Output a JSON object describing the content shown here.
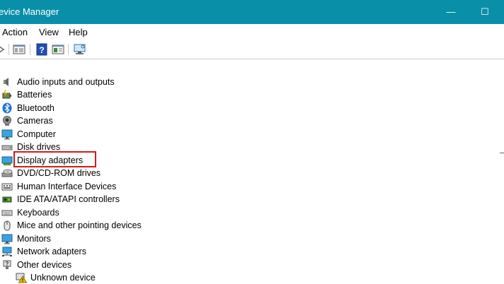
{
  "window": {
    "title": "evice Manager",
    "minimize_glyph": "—",
    "maximize_glyph": "☐"
  },
  "menu": {
    "items": [
      "Action",
      "View",
      "Help"
    ]
  },
  "toolbar": {
    "icons": [
      "forward-arrow-icon",
      "properties-icon",
      "help-icon",
      "update-driver-icon",
      "scan-hardware-icon"
    ]
  },
  "tree": {
    "categories": [
      {
        "label": "Audio inputs and outputs",
        "icon": "speaker-icon"
      },
      {
        "label": "Batteries",
        "icon": "battery-icon"
      },
      {
        "label": "Bluetooth",
        "icon": "bluetooth-icon"
      },
      {
        "label": "Cameras",
        "icon": "camera-icon"
      },
      {
        "label": "Computer",
        "icon": "computer-icon"
      },
      {
        "label": "Disk drives",
        "icon": "disk-drive-icon"
      },
      {
        "label": "Display adapters",
        "icon": "display-adapter-icon"
      },
      {
        "label": "DVD/CD-ROM drives",
        "icon": "dvd-drive-icon"
      },
      {
        "label": "Human Interface Devices",
        "icon": "hid-icon"
      },
      {
        "label": "IDE ATA/ATAPI controllers",
        "icon": "ide-controller-icon"
      },
      {
        "label": "Keyboards",
        "icon": "keyboard-icon"
      },
      {
        "label": "Mice and other pointing devices",
        "icon": "mouse-icon"
      },
      {
        "label": "Monitors",
        "icon": "monitor-icon"
      },
      {
        "label": "Network adapters",
        "icon": "network-adapter-icon"
      },
      {
        "label": "Other devices",
        "icon": "other-devices-icon"
      }
    ],
    "children": [
      {
        "label": "Unknown device",
        "icon": "unknown-device-warning-icon"
      }
    ]
  },
  "highlight": {
    "target": "Display adapters",
    "color": "#d21b1b"
  },
  "colors": {
    "titlebar": "#0a8fa8"
  }
}
